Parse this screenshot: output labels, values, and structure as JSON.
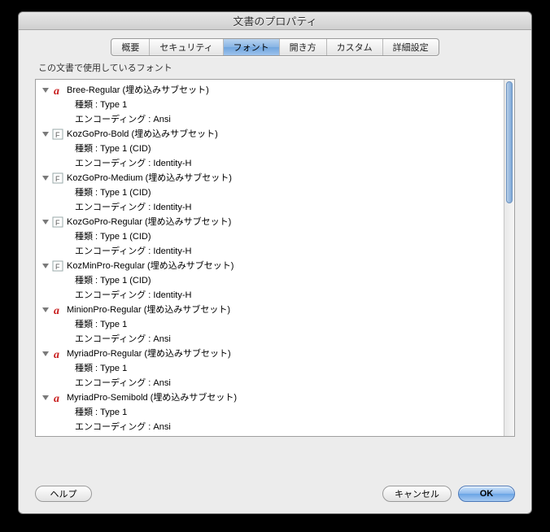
{
  "window": {
    "title": "文書のプロパティ"
  },
  "tabs": [
    {
      "label": "概要",
      "selected": false
    },
    {
      "label": "セキュリティ",
      "selected": false
    },
    {
      "label": "フォント",
      "selected": true
    },
    {
      "label": "開き方",
      "selected": false
    },
    {
      "label": "カスタム",
      "selected": false
    },
    {
      "label": "詳細設定",
      "selected": false
    }
  ],
  "section_label": "この文書で使用しているフォント",
  "detail_labels": {
    "type": "種類",
    "encoding": "エンコーディング"
  },
  "fonts": [
    {
      "name": "Bree-Regular (埋め込みサブセット)",
      "icon": "a",
      "type": "Type 1",
      "encoding": "Ansi"
    },
    {
      "name": "KozGoPro-Bold (埋め込みサブセット)",
      "icon": "F",
      "type": "Type 1 (CID)",
      "encoding": "Identity-H"
    },
    {
      "name": "KozGoPro-Medium (埋め込みサブセット)",
      "icon": "F",
      "type": "Type 1 (CID)",
      "encoding": "Identity-H"
    },
    {
      "name": "KozGoPro-Regular (埋め込みサブセット)",
      "icon": "F",
      "type": "Type 1 (CID)",
      "encoding": "Identity-H"
    },
    {
      "name": "KozMinPro-Regular (埋め込みサブセット)",
      "icon": "F",
      "type": "Type 1 (CID)",
      "encoding": "Identity-H"
    },
    {
      "name": "MinionPro-Regular (埋め込みサブセット)",
      "icon": "a",
      "type": "Type 1",
      "encoding": "Ansi"
    },
    {
      "name": "MyriadPro-Regular (埋め込みサブセット)",
      "icon": "a",
      "type": "Type 1",
      "encoding": "Ansi"
    },
    {
      "name": "MyriadPro-Semibold (埋め込みサブセット)",
      "icon": "a",
      "type": "Type 1",
      "encoding": "Ansi"
    }
  ],
  "buttons": {
    "help": "ヘルプ",
    "cancel": "キャンセル",
    "ok": "OK"
  }
}
